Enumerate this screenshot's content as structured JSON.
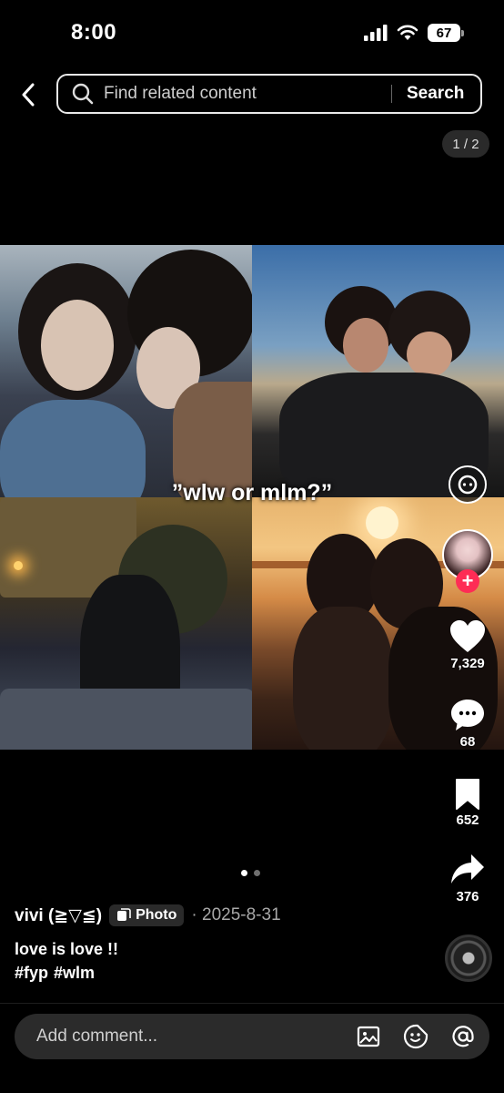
{
  "status_bar": {
    "time": "8:00",
    "battery": "67"
  },
  "search": {
    "placeholder": "Find related content",
    "button_label": "Search"
  },
  "page_counter": "1 / 2",
  "post": {
    "overlay_text": "”wlw or mlm?”",
    "author": "vivi (≧▽≦)",
    "type_badge": "Photo",
    "date": "· 2025-8-31",
    "caption": "love is love !!",
    "hashtags": [
      "#fyp",
      "#wlm"
    ],
    "carousel": {
      "total": 2,
      "active_index": 0
    }
  },
  "actions": {
    "likes": "7,329",
    "comments": "68",
    "saves": "652",
    "shares": "376"
  },
  "comment_bar": {
    "placeholder": "Add comment..."
  },
  "colors": {
    "follow_accent": "#fe2c55",
    "background": "#000000"
  },
  "icons": [
    "back-arrow-icon",
    "search-icon",
    "scan-icon",
    "heart-icon",
    "comment-icon",
    "bookmark-icon",
    "share-icon",
    "image-icon",
    "emoji-icon",
    "mention-icon"
  ]
}
